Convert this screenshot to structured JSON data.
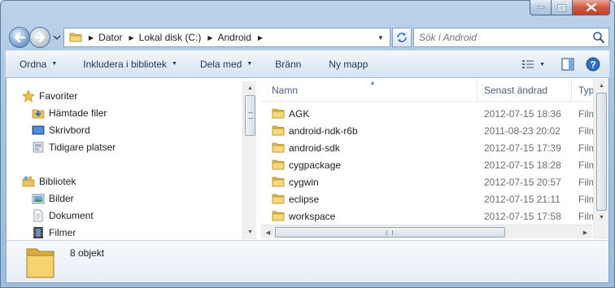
{
  "window": {
    "caption_buttons": [
      "minimize",
      "maximize",
      "close"
    ],
    "accent": "#c13f25"
  },
  "address": {
    "crumbs": [
      "Dator",
      "Lokal disk (C:)",
      "Android"
    ]
  },
  "search": {
    "placeholder": "Sök i Android"
  },
  "toolbar": {
    "organize": "Ordna",
    "include": "Inkludera i bibliotek",
    "share": "Dela med",
    "burn": "Bränn",
    "new_folder": "Ny mapp"
  },
  "nav": {
    "favorites": {
      "label": "Favoriter",
      "items": [
        "Hämtade filer",
        "Skrivbord",
        "Tidigare platser"
      ]
    },
    "libraries": {
      "label": "Bibliotek",
      "items": [
        "Bilder",
        "Dokument",
        "Filmer"
      ]
    }
  },
  "columns": {
    "name": "Namn",
    "date": "Senast ändrad",
    "type": "Typ"
  },
  "files": [
    {
      "name": "AGK",
      "date": "2012-07-15 18:36",
      "type": "Film"
    },
    {
      "name": "android-ndk-r6b",
      "date": "2011-08-23 20:02",
      "type": "Film"
    },
    {
      "name": "android-sdk",
      "date": "2012-07-15 17:39",
      "type": "Film"
    },
    {
      "name": "cygpackage",
      "date": "2012-07-15 18:28",
      "type": "Film"
    },
    {
      "name": "cygwin",
      "date": "2012-07-15 20:57",
      "type": "Film"
    },
    {
      "name": "eclipse",
      "date": "2012-07-15 21:11",
      "type": "Film"
    },
    {
      "name": "workspace",
      "date": "2012-07-15 17:58",
      "type": "Film"
    }
  ],
  "details": {
    "count": "8 objekt"
  }
}
